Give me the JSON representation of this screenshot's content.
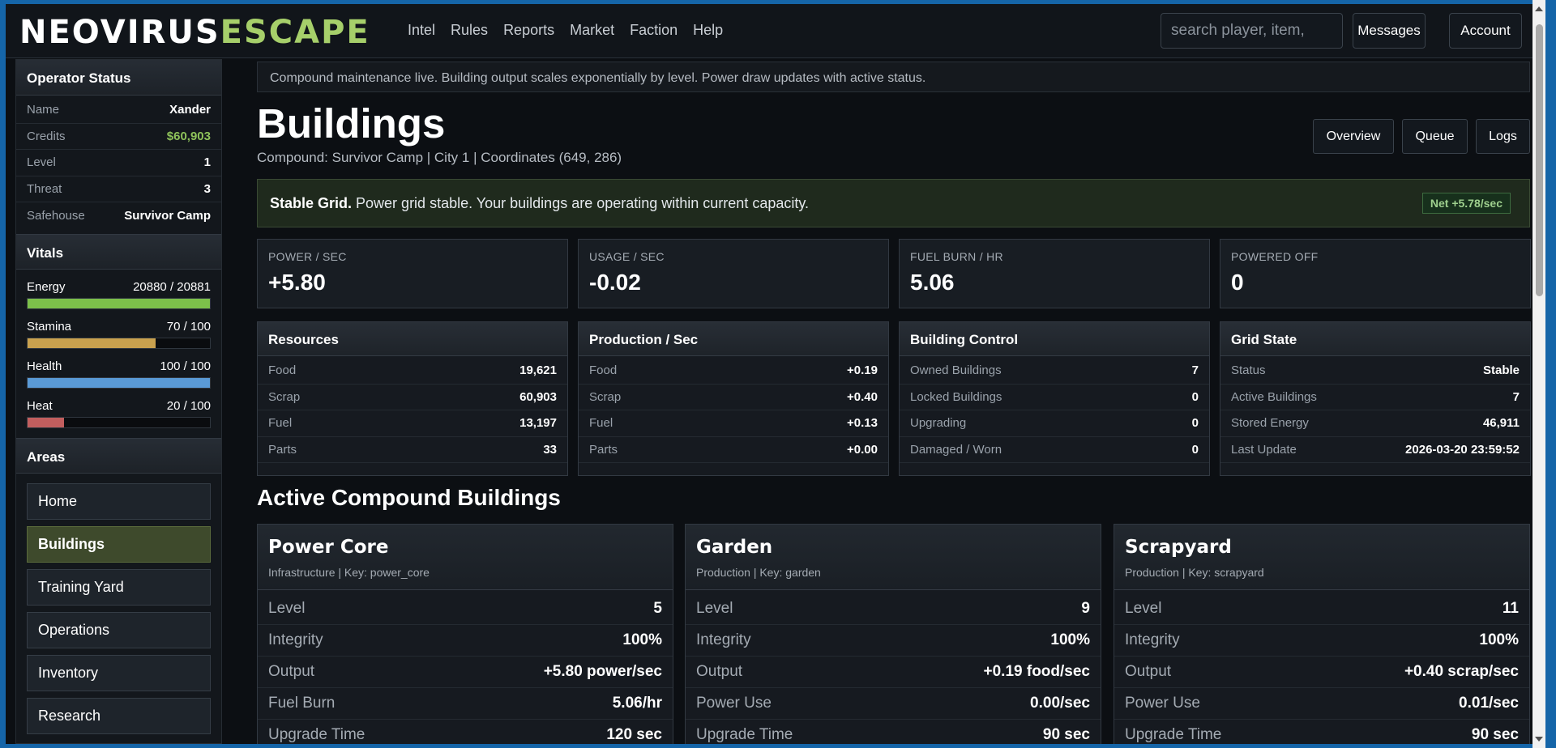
{
  "brand": {
    "part1": "NEOVIRUS",
    "part2": "ESCAPE"
  },
  "nav": [
    "Intel",
    "Rules",
    "Reports",
    "Market",
    "Faction",
    "Help"
  ],
  "search": {
    "placeholder": "search player, item,"
  },
  "top_buttons": {
    "messages": "Messages",
    "account": "Account"
  },
  "sidebar": {
    "status_title": "Operator Status",
    "status": [
      {
        "k": "Name",
        "v": "Xander"
      },
      {
        "k": "Credits",
        "v": "$60,903"
      },
      {
        "k": "Level",
        "v": "1"
      },
      {
        "k": "Threat",
        "v": "3"
      },
      {
        "k": "Safehouse",
        "v": "Survivor Camp"
      }
    ],
    "vitals_title": "Vitals",
    "vitals": [
      {
        "name": "Energy",
        "value": "20880 / 20881",
        "fraction": 0.9999,
        "color": "#7cc04a"
      },
      {
        "name": "Stamina",
        "value": "70 / 100",
        "fraction": 0.7,
        "color": "#c9a14e"
      },
      {
        "name": "Health",
        "value": "100 / 100",
        "fraction": 1.0,
        "color": "#5a9ad6"
      },
      {
        "name": "Heat",
        "value": "20 / 100",
        "fraction": 0.2,
        "color": "#c25e5e"
      }
    ],
    "areas_title": "Areas",
    "areas": [
      "Home",
      "Buildings",
      "Training Yard",
      "Operations",
      "Inventory",
      "Research"
    ],
    "active_area": "Buildings"
  },
  "notice": "Compound maintenance live. Building output scales exponentially by level. Power draw updates with active status.",
  "page": {
    "title": "Buildings",
    "subtitle": "Compound: Survivor Camp | City 1 | Coordinates (649, 286)",
    "buttons": {
      "overview": "Overview",
      "queue": "Queue",
      "logs": "Logs"
    }
  },
  "alert": {
    "bold": "Stable Grid.",
    "text": " Power grid stable. Your buildings are operating within current capacity.",
    "badge": "Net +5.78/sec"
  },
  "stats": [
    {
      "label": "POWER / SEC",
      "value": "+5.80"
    },
    {
      "label": "USAGE / SEC",
      "value": "-0.02"
    },
    {
      "label": "FUEL BURN / HR",
      "value": "5.06"
    },
    {
      "label": "POWERED OFF",
      "value": "0"
    }
  ],
  "panels": [
    {
      "title": "Resources",
      "rows": [
        {
          "k": "Food",
          "v": "19,621"
        },
        {
          "k": "Scrap",
          "v": "60,903"
        },
        {
          "k": "Fuel",
          "v": "13,197"
        },
        {
          "k": "Parts",
          "v": "33"
        }
      ]
    },
    {
      "title": "Production / Sec",
      "rows": [
        {
          "k": "Food",
          "v": "+0.19"
        },
        {
          "k": "Scrap",
          "v": "+0.40"
        },
        {
          "k": "Fuel",
          "v": "+0.13"
        },
        {
          "k": "Parts",
          "v": "+0.00"
        }
      ]
    },
    {
      "title": "Building Control",
      "rows": [
        {
          "k": "Owned Buildings",
          "v": "7"
        },
        {
          "k": "Locked Buildings",
          "v": "0"
        },
        {
          "k": "Upgrading",
          "v": "0"
        },
        {
          "k": "Damaged / Worn",
          "v": "0"
        }
      ]
    },
    {
      "title": "Grid State",
      "rows": [
        {
          "k": "Status",
          "v": "Stable"
        },
        {
          "k": "Active Buildings",
          "v": "7"
        },
        {
          "k": "Stored Energy",
          "v": "46,911"
        },
        {
          "k": "Last Update",
          "v": "2026-03-20 23:59:52"
        }
      ]
    }
  ],
  "section_title": "Active Compound Buildings",
  "buildings": [
    {
      "name": "Power Core",
      "meta": "Infrastructure | Key: power_core",
      "rows": [
        {
          "k": "Level",
          "v": "5"
        },
        {
          "k": "Integrity",
          "v": "100%"
        },
        {
          "k": "Output",
          "v": "+5.80 power/sec"
        },
        {
          "k": "Fuel Burn",
          "v": "5.06/hr"
        },
        {
          "k": "Upgrade Time",
          "v": "120 sec"
        }
      ]
    },
    {
      "name": "Garden",
      "meta": "Production | Key: garden",
      "rows": [
        {
          "k": "Level",
          "v": "9"
        },
        {
          "k": "Integrity",
          "v": "100%"
        },
        {
          "k": "Output",
          "v": "+0.19 food/sec"
        },
        {
          "k": "Power Use",
          "v": "0.00/sec"
        },
        {
          "k": "Upgrade Time",
          "v": "90 sec"
        }
      ]
    },
    {
      "name": "Scrapyard",
      "meta": "Production | Key: scrapyard",
      "rows": [
        {
          "k": "Level",
          "v": "11"
        },
        {
          "k": "Integrity",
          "v": "100%"
        },
        {
          "k": "Output",
          "v": "+0.40 scrap/sec"
        },
        {
          "k": "Power Use",
          "v": "0.01/sec"
        },
        {
          "k": "Upgrade Time",
          "v": "90 sec"
        }
      ]
    }
  ]
}
